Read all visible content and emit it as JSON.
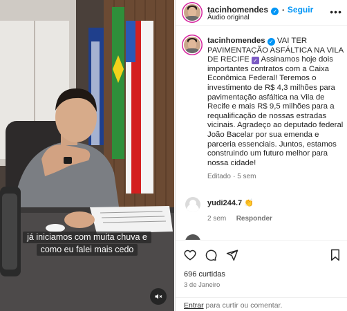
{
  "video": {
    "caption_line1": "já iniciamos com muita chuva e",
    "caption_line2": "como eu falei mais cedo"
  },
  "header": {
    "username": "tacinhomendes",
    "separator": "•",
    "follow_label": "Seguir",
    "audio_label": "Áudio original"
  },
  "post": {
    "username": "tacinhomendes",
    "text_upper": "VAI TER PAVIMENTAÇÃO ASFÁLTICA NA VILA DE RECIFE",
    "text_body": "Assinamos hoje dois importantes contratos com a Caixa Econômica Federal! Teremos o investimento de R$ 4,3 milhões para pavimentação asfáltica na Vila de Recife e mais R$ 9,5 milhões para a requalificação de nossas estradas vicinais. Agradeço ao deputado federal João Bacelar por sua emenda e parceria essenciais. Juntos, estamos construindo um futuro melhor para nossa cidade!",
    "edited_label": "Editado",
    "time_ago": "5 sem"
  },
  "comments": [
    {
      "username": "yudi244.7",
      "emoji": "👏",
      "time_ago": "2 sem",
      "reply_label": "Responder"
    }
  ],
  "actions": {
    "likes_text": "696 curtidas",
    "date_text": "3 de Janeiro",
    "comment_prefix": "Entrar",
    "comment_suffix": " para curtir ou comentar."
  },
  "colors": {
    "accent": "#0095f6",
    "text": "#262626",
    "muted": "#737373",
    "border": "#dbdbdb"
  }
}
